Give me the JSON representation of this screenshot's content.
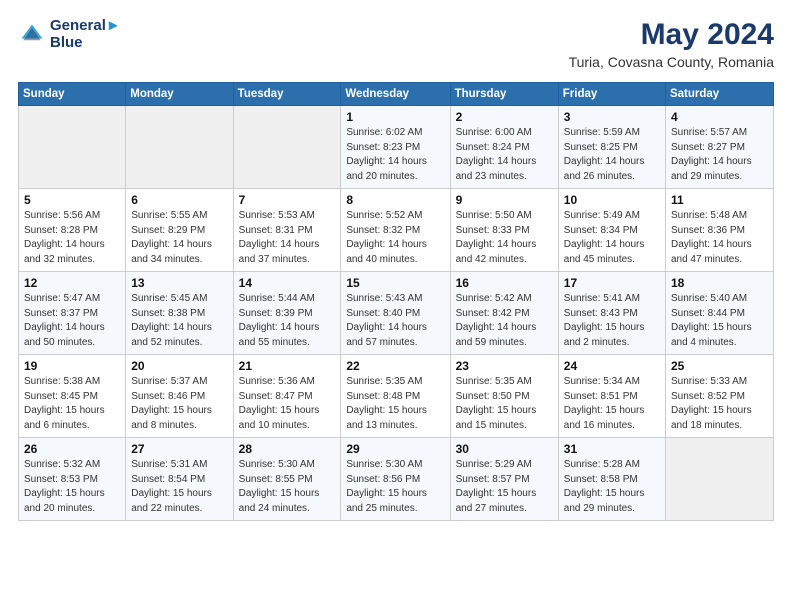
{
  "header": {
    "logo_line1": "General",
    "logo_line2": "Blue",
    "month_title": "May 2024",
    "location": "Turia, Covasna County, Romania"
  },
  "weekdays": [
    "Sunday",
    "Monday",
    "Tuesday",
    "Wednesday",
    "Thursday",
    "Friday",
    "Saturday"
  ],
  "weeks": [
    [
      {
        "day": "",
        "sunrise": "",
        "sunset": "",
        "daylight": ""
      },
      {
        "day": "",
        "sunrise": "",
        "sunset": "",
        "daylight": ""
      },
      {
        "day": "",
        "sunrise": "",
        "sunset": "",
        "daylight": ""
      },
      {
        "day": "1",
        "sunrise": "Sunrise: 6:02 AM",
        "sunset": "Sunset: 8:23 PM",
        "daylight": "Daylight: 14 hours and 20 minutes."
      },
      {
        "day": "2",
        "sunrise": "Sunrise: 6:00 AM",
        "sunset": "Sunset: 8:24 PM",
        "daylight": "Daylight: 14 hours and 23 minutes."
      },
      {
        "day": "3",
        "sunrise": "Sunrise: 5:59 AM",
        "sunset": "Sunset: 8:25 PM",
        "daylight": "Daylight: 14 hours and 26 minutes."
      },
      {
        "day": "4",
        "sunrise": "Sunrise: 5:57 AM",
        "sunset": "Sunset: 8:27 PM",
        "daylight": "Daylight: 14 hours and 29 minutes."
      }
    ],
    [
      {
        "day": "5",
        "sunrise": "Sunrise: 5:56 AM",
        "sunset": "Sunset: 8:28 PM",
        "daylight": "Daylight: 14 hours and 32 minutes."
      },
      {
        "day": "6",
        "sunrise": "Sunrise: 5:55 AM",
        "sunset": "Sunset: 8:29 PM",
        "daylight": "Daylight: 14 hours and 34 minutes."
      },
      {
        "day": "7",
        "sunrise": "Sunrise: 5:53 AM",
        "sunset": "Sunset: 8:31 PM",
        "daylight": "Daylight: 14 hours and 37 minutes."
      },
      {
        "day": "8",
        "sunrise": "Sunrise: 5:52 AM",
        "sunset": "Sunset: 8:32 PM",
        "daylight": "Daylight: 14 hours and 40 minutes."
      },
      {
        "day": "9",
        "sunrise": "Sunrise: 5:50 AM",
        "sunset": "Sunset: 8:33 PM",
        "daylight": "Daylight: 14 hours and 42 minutes."
      },
      {
        "day": "10",
        "sunrise": "Sunrise: 5:49 AM",
        "sunset": "Sunset: 8:34 PM",
        "daylight": "Daylight: 14 hours and 45 minutes."
      },
      {
        "day": "11",
        "sunrise": "Sunrise: 5:48 AM",
        "sunset": "Sunset: 8:36 PM",
        "daylight": "Daylight: 14 hours and 47 minutes."
      }
    ],
    [
      {
        "day": "12",
        "sunrise": "Sunrise: 5:47 AM",
        "sunset": "Sunset: 8:37 PM",
        "daylight": "Daylight: 14 hours and 50 minutes."
      },
      {
        "day": "13",
        "sunrise": "Sunrise: 5:45 AM",
        "sunset": "Sunset: 8:38 PM",
        "daylight": "Daylight: 14 hours and 52 minutes."
      },
      {
        "day": "14",
        "sunrise": "Sunrise: 5:44 AM",
        "sunset": "Sunset: 8:39 PM",
        "daylight": "Daylight: 14 hours and 55 minutes."
      },
      {
        "day": "15",
        "sunrise": "Sunrise: 5:43 AM",
        "sunset": "Sunset: 8:40 PM",
        "daylight": "Daylight: 14 hours and 57 minutes."
      },
      {
        "day": "16",
        "sunrise": "Sunrise: 5:42 AM",
        "sunset": "Sunset: 8:42 PM",
        "daylight": "Daylight: 14 hours and 59 minutes."
      },
      {
        "day": "17",
        "sunrise": "Sunrise: 5:41 AM",
        "sunset": "Sunset: 8:43 PM",
        "daylight": "Daylight: 15 hours and 2 minutes."
      },
      {
        "day": "18",
        "sunrise": "Sunrise: 5:40 AM",
        "sunset": "Sunset: 8:44 PM",
        "daylight": "Daylight: 15 hours and 4 minutes."
      }
    ],
    [
      {
        "day": "19",
        "sunrise": "Sunrise: 5:38 AM",
        "sunset": "Sunset: 8:45 PM",
        "daylight": "Daylight: 15 hours and 6 minutes."
      },
      {
        "day": "20",
        "sunrise": "Sunrise: 5:37 AM",
        "sunset": "Sunset: 8:46 PM",
        "daylight": "Daylight: 15 hours and 8 minutes."
      },
      {
        "day": "21",
        "sunrise": "Sunrise: 5:36 AM",
        "sunset": "Sunset: 8:47 PM",
        "daylight": "Daylight: 15 hours and 10 minutes."
      },
      {
        "day": "22",
        "sunrise": "Sunrise: 5:35 AM",
        "sunset": "Sunset: 8:48 PM",
        "daylight": "Daylight: 15 hours and 13 minutes."
      },
      {
        "day": "23",
        "sunrise": "Sunrise: 5:35 AM",
        "sunset": "Sunset: 8:50 PM",
        "daylight": "Daylight: 15 hours and 15 minutes."
      },
      {
        "day": "24",
        "sunrise": "Sunrise: 5:34 AM",
        "sunset": "Sunset: 8:51 PM",
        "daylight": "Daylight: 15 hours and 16 minutes."
      },
      {
        "day": "25",
        "sunrise": "Sunrise: 5:33 AM",
        "sunset": "Sunset: 8:52 PM",
        "daylight": "Daylight: 15 hours and 18 minutes."
      }
    ],
    [
      {
        "day": "26",
        "sunrise": "Sunrise: 5:32 AM",
        "sunset": "Sunset: 8:53 PM",
        "daylight": "Daylight: 15 hours and 20 minutes."
      },
      {
        "day": "27",
        "sunrise": "Sunrise: 5:31 AM",
        "sunset": "Sunset: 8:54 PM",
        "daylight": "Daylight: 15 hours and 22 minutes."
      },
      {
        "day": "28",
        "sunrise": "Sunrise: 5:30 AM",
        "sunset": "Sunset: 8:55 PM",
        "daylight": "Daylight: 15 hours and 24 minutes."
      },
      {
        "day": "29",
        "sunrise": "Sunrise: 5:30 AM",
        "sunset": "Sunset: 8:56 PM",
        "daylight": "Daylight: 15 hours and 25 minutes."
      },
      {
        "day": "30",
        "sunrise": "Sunrise: 5:29 AM",
        "sunset": "Sunset: 8:57 PM",
        "daylight": "Daylight: 15 hours and 27 minutes."
      },
      {
        "day": "31",
        "sunrise": "Sunrise: 5:28 AM",
        "sunset": "Sunset: 8:58 PM",
        "daylight": "Daylight: 15 hours and 29 minutes."
      },
      {
        "day": "",
        "sunrise": "",
        "sunset": "",
        "daylight": ""
      }
    ]
  ]
}
